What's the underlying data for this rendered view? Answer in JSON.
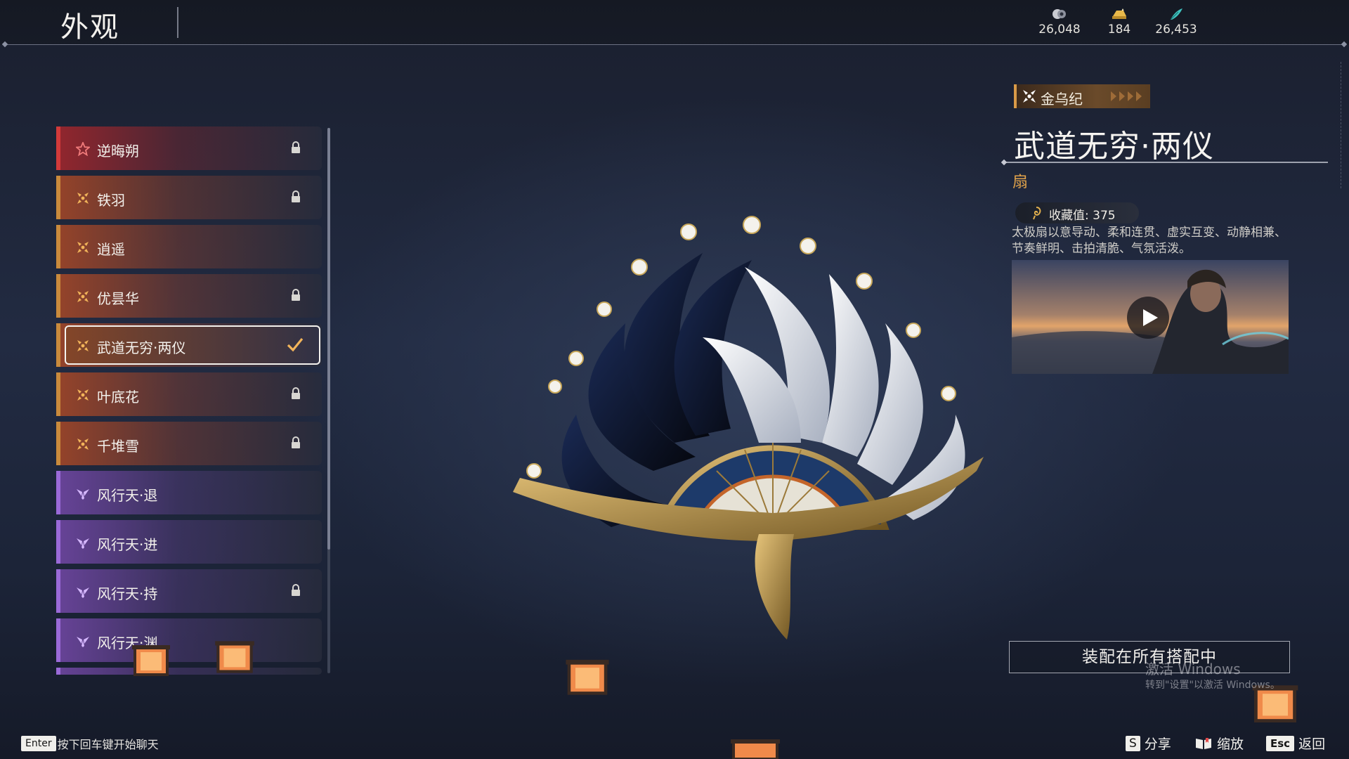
{
  "header": {
    "title": "外观",
    "currencies": [
      {
        "icon": "coin-icon",
        "value": "26,048"
      },
      {
        "icon": "gold-ingot-icon",
        "value": "184"
      },
      {
        "icon": "jade-feather-icon",
        "value": "26,453"
      }
    ]
  },
  "outfit_list": {
    "items": [
      {
        "label": "逆晦朔",
        "rarity": "red",
        "locked": true
      },
      {
        "label": "铁羽",
        "rarity": "orange",
        "locked": true
      },
      {
        "label": "逍遥",
        "rarity": "orange",
        "locked": false
      },
      {
        "label": "优昙华",
        "rarity": "orange",
        "locked": true
      },
      {
        "label": "武道无穷·两仪",
        "rarity": "orange",
        "locked": false,
        "selected": true
      },
      {
        "label": "叶底花",
        "rarity": "orange",
        "locked": true
      },
      {
        "label": "千堆雪",
        "rarity": "orange",
        "locked": true
      },
      {
        "label": "风行天·退",
        "rarity": "purple",
        "locked": false
      },
      {
        "label": "风行天·进",
        "rarity": "purple",
        "locked": false
      },
      {
        "label": "风行天·持",
        "rarity": "purple",
        "locked": true
      },
      {
        "label": "风行天·渊",
        "rarity": "purple",
        "locked": false
      }
    ]
  },
  "detail": {
    "set_name": "金乌纪",
    "item_name": "武道无穷·两仪",
    "item_type": "扇",
    "collection_label": "收藏值: 375",
    "description": "太极扇以意导动、柔和连贯、虚实互变、动静相兼、节奏鲜明、击拍清脆、气氛活泼。",
    "equip_button": "装配在所有搭配中"
  },
  "watermark": {
    "line1": "激活 Windows",
    "line2": "转到\"设置\"以激活 Windows。"
  },
  "footer": {
    "chat_key": "Enter",
    "chat_hint": "按下回车键开始聊天",
    "actions": [
      {
        "key": "S",
        "label": "分享"
      },
      {
        "icon": "book-icon",
        "label": "缩放"
      },
      {
        "key": "Esc",
        "label": "返回"
      }
    ]
  },
  "colors": {
    "accent_orange": "#c98a3c",
    "rarity_red": "#d23a3a",
    "rarity_purple": "#9a6ad8",
    "type_text": "#e0a24a"
  }
}
